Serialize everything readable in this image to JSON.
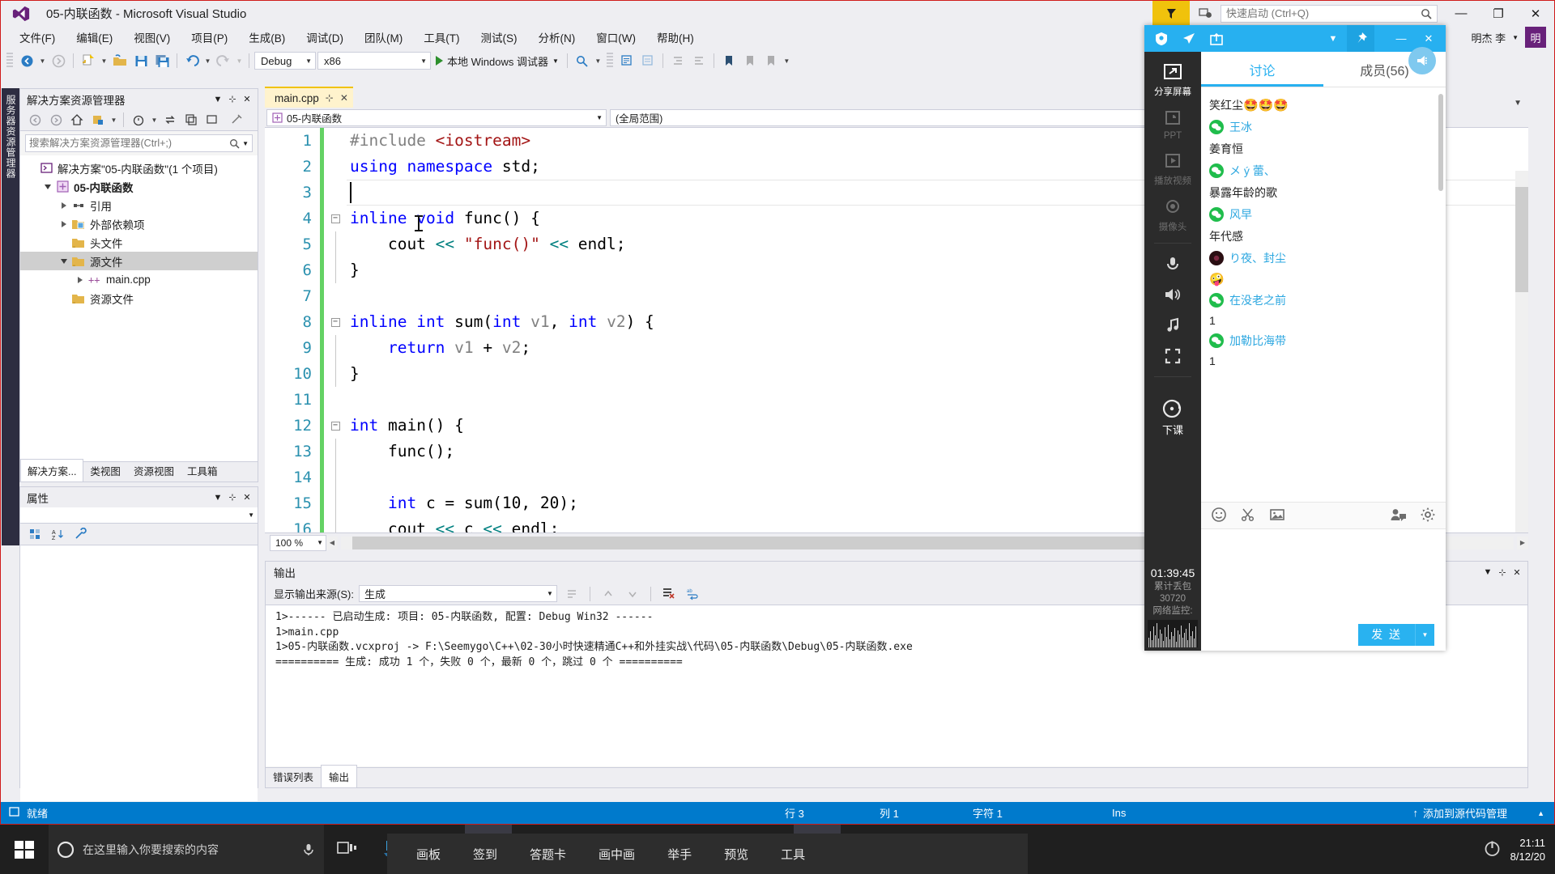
{
  "window": {
    "title": "05-内联函数 - Microsoft Visual Studio",
    "logo_icon": "visual-studio-icon",
    "feedback_icon": "feedback-flag-icon",
    "notify_icon": "notification-icon",
    "minimize": "—",
    "restore": "❐",
    "close": "✕",
    "user_name": "明杰 李",
    "avatar_initial": "明"
  },
  "quick_launch": {
    "placeholder": "快速启动 (Ctrl+Q)",
    "value": "",
    "icon": "search-icon"
  },
  "menu": [
    {
      "label": "文件(F)"
    },
    {
      "label": "编辑(E)"
    },
    {
      "label": "视图(V)"
    },
    {
      "label": "项目(P)"
    },
    {
      "label": "生成(B)"
    },
    {
      "label": "调试(D)"
    },
    {
      "label": "团队(M)"
    },
    {
      "label": "工具(T)"
    },
    {
      "label": "测试(S)"
    },
    {
      "label": "分析(N)"
    },
    {
      "label": "窗口(W)"
    },
    {
      "label": "帮助(H)"
    }
  ],
  "toolbar": {
    "config": "Debug",
    "platform": "x86",
    "run_label": "本地 Windows 调试器"
  },
  "left_strip": {
    "label": "服务器资源管理器"
  },
  "solution_explorer": {
    "title": "解决方案资源管理器",
    "search_placeholder": "搜索解决方案资源管理器(Ctrl+;)",
    "tree": [
      {
        "label": "解决方案\"05-内联函数\"(1 个项目)",
        "depth": 0,
        "twisty": "none",
        "icon": "solution-icon",
        "bold": false,
        "selected": false
      },
      {
        "label": "05-内联函数",
        "depth": 1,
        "twisty": "down",
        "icon": "project-icon",
        "bold": true,
        "selected": false
      },
      {
        "label": "引用",
        "depth": 2,
        "twisty": "right",
        "icon": "references-icon",
        "bold": false,
        "selected": false
      },
      {
        "label": "外部依赖项",
        "depth": 2,
        "twisty": "right",
        "icon": "external-deps-icon",
        "bold": false,
        "selected": false
      },
      {
        "label": "头文件",
        "depth": 2,
        "twisty": "none",
        "icon": "folder-icon",
        "bold": false,
        "selected": false
      },
      {
        "label": "源文件",
        "depth": 2,
        "twisty": "down",
        "icon": "folder-icon",
        "bold": false,
        "selected": true
      },
      {
        "label": "main.cpp",
        "depth": 3,
        "twisty": "right",
        "icon": "cpp-file-icon",
        "bold": false,
        "selected": false
      },
      {
        "label": "资源文件",
        "depth": 2,
        "twisty": "none",
        "icon": "folder-icon",
        "bold": false,
        "selected": false
      }
    ],
    "tabs": [
      {
        "label": "解决方案...",
        "active": true
      },
      {
        "label": "类视图",
        "active": false
      },
      {
        "label": "资源视图",
        "active": false
      },
      {
        "label": "工具箱",
        "active": false
      }
    ]
  },
  "properties_panel": {
    "title": "属性"
  },
  "editor": {
    "tab": {
      "label": "main.cpp",
      "pin": "⊹",
      "close": "✕"
    },
    "nav_scope": "05-内联函数",
    "nav_member": "(全局范围)",
    "zoom": "100 %",
    "lines": [
      {
        "n": "1",
        "change": true,
        "fold": "",
        "tokens": [
          {
            "t": "#include ",
            "c": "pp"
          },
          {
            "t": "<iostream>",
            "c": "inc"
          }
        ]
      },
      {
        "n": "2",
        "change": true,
        "fold": "",
        "tokens": [
          {
            "t": "using",
            "c": "k"
          },
          {
            "t": " ",
            "c": "pl"
          },
          {
            "t": "namespace",
            "c": "k"
          },
          {
            "t": " std;",
            "c": "pl"
          }
        ]
      },
      {
        "n": "3",
        "change": true,
        "fold": "",
        "tokens": [
          {
            "t": "",
            "c": "pl"
          }
        ],
        "caret": true
      },
      {
        "n": "4",
        "change": true,
        "fold": "minus",
        "tokens": [
          {
            "t": "inline",
            "c": "k"
          },
          {
            "t": " ",
            "c": "pl"
          },
          {
            "t": "void",
            "c": "k"
          },
          {
            "t": " func() {",
            "c": "pl"
          }
        ]
      },
      {
        "n": "5",
        "change": true,
        "fold": "",
        "tokens": [
          {
            "t": "    cout ",
            "c": "pl"
          },
          {
            "t": "<<",
            "c": "op"
          },
          {
            "t": " ",
            "c": "pl"
          },
          {
            "t": "\"func()\"",
            "c": "str"
          },
          {
            "t": " ",
            "c": "pl"
          },
          {
            "t": "<<",
            "c": "op"
          },
          {
            "t": " endl;",
            "c": "pl"
          }
        ]
      },
      {
        "n": "6",
        "change": true,
        "fold": "",
        "tokens": [
          {
            "t": "}",
            "c": "pl"
          }
        ]
      },
      {
        "n": "7",
        "change": true,
        "fold": "",
        "tokens": [
          {
            "t": "",
            "c": "pl"
          }
        ]
      },
      {
        "n": "8",
        "change": true,
        "fold": "minus",
        "tokens": [
          {
            "t": "inline",
            "c": "k"
          },
          {
            "t": " ",
            "c": "pl"
          },
          {
            "t": "int",
            "c": "k"
          },
          {
            "t": " sum(",
            "c": "pl"
          },
          {
            "t": "int",
            "c": "k"
          },
          {
            "t": " ",
            "c": "pl"
          },
          {
            "t": "v1",
            "c": "id"
          },
          {
            "t": ", ",
            "c": "pl"
          },
          {
            "t": "int",
            "c": "k"
          },
          {
            "t": " ",
            "c": "pl"
          },
          {
            "t": "v2",
            "c": "id"
          },
          {
            "t": ") {",
            "c": "pl"
          }
        ]
      },
      {
        "n": "9",
        "change": true,
        "fold": "",
        "tokens": [
          {
            "t": "    ",
            "c": "pl"
          },
          {
            "t": "return",
            "c": "k"
          },
          {
            "t": " ",
            "c": "pl"
          },
          {
            "t": "v1",
            "c": "id"
          },
          {
            "t": " + ",
            "c": "pl"
          },
          {
            "t": "v2",
            "c": "id"
          },
          {
            "t": ";",
            "c": "pl"
          }
        ]
      },
      {
        "n": "10",
        "change": true,
        "fold": "",
        "tokens": [
          {
            "t": "}",
            "c": "pl"
          }
        ]
      },
      {
        "n": "11",
        "change": true,
        "fold": "",
        "tokens": [
          {
            "t": "",
            "c": "pl"
          }
        ]
      },
      {
        "n": "12",
        "change": true,
        "fold": "minus",
        "tokens": [
          {
            "t": "int",
            "c": "k"
          },
          {
            "t": " main() {",
            "c": "pl"
          }
        ]
      },
      {
        "n": "13",
        "change": true,
        "fold": "",
        "tokens": [
          {
            "t": "    func();",
            "c": "pl"
          }
        ]
      },
      {
        "n": "14",
        "change": true,
        "fold": "",
        "tokens": [
          {
            "t": "",
            "c": "pl"
          }
        ]
      },
      {
        "n": "15",
        "change": true,
        "fold": "",
        "tokens": [
          {
            "t": "    ",
            "c": "pl"
          },
          {
            "t": "int",
            "c": "k"
          },
          {
            "t": " c = sum(",
            "c": "pl"
          },
          {
            "t": "10",
            "c": "pl"
          },
          {
            "t": ", ",
            "c": "pl"
          },
          {
            "t": "20",
            "c": "pl"
          },
          {
            "t": ");",
            "c": "pl"
          }
        ]
      },
      {
        "n": "16",
        "change": true,
        "fold": "",
        "tokens": [
          {
            "t": "    cout ",
            "c": "pl"
          },
          {
            "t": "<<",
            "c": "op"
          },
          {
            "t": " c ",
            "c": "pl"
          },
          {
            "t": "<<",
            "c": "op"
          },
          {
            "t": " endl;",
            "c": "pl"
          }
        ]
      }
    ]
  },
  "output_panel": {
    "title": "输出",
    "source_label": "显示输出来源(S):",
    "source_value": "生成",
    "lines": [
      "1>------ 已启动生成: 项目: 05-内联函数, 配置: Debug Win32 ------",
      "1>main.cpp",
      "1>05-内联函数.vcxproj -> F:\\Seemygo\\C++\\02-30小时快速精通C++和外挂实战\\代码\\05-内联函数\\Debug\\05-内联函数.exe",
      "========== 生成: 成功 1 个，失败 0 个，最新 0 个，跳过 0 个 =========="
    ],
    "tabs": [
      {
        "label": "错误列表",
        "active": false
      },
      {
        "label": "输出",
        "active": true
      }
    ]
  },
  "status_bar": {
    "state": "就绪",
    "row_label": "行 3",
    "col_label": "列 1",
    "char_label": "字符 1",
    "insert_mode": "Ins",
    "source_control": "添加到源代码管理",
    "source_control_icon": "upload-arrow-icon"
  },
  "meeting": {
    "titlebar_icons": [
      "shield-icon",
      "airplane-icon",
      "share-icon",
      "chevron-down-icon",
      "pin-icon"
    ],
    "minimize": "—",
    "close": "✕",
    "rail": [
      {
        "label": "分享屏幕",
        "icon": "share-screen-icon",
        "state": "active"
      },
      {
        "label": "PPT",
        "icon": "ppt-icon",
        "state": "dim"
      },
      {
        "label": "播放视频",
        "icon": "play-video-icon",
        "state": "dim"
      },
      {
        "label": "摄像头",
        "icon": "camera-icon",
        "state": "dim"
      }
    ],
    "rail_icons": [
      {
        "icon": "microphone-icon"
      },
      {
        "icon": "speaker-icon"
      },
      {
        "icon": "music-icon"
      },
      {
        "icon": "fullscreen-icon"
      }
    ],
    "end_class": {
      "label": "下课",
      "icon": "power-ring-icon"
    },
    "timer": "01:39:45",
    "stats_label": "累计丢包",
    "stats_value": "30720",
    "net_label": "网络监控:",
    "tabs": [
      {
        "label": "讨论",
        "active": true
      },
      {
        "label": "成员(56)",
        "active": false
      }
    ],
    "speaker_badge_icon": "megaphone-icon",
    "chat": [
      {
        "type": "msg",
        "text": "笑红尘",
        "emojis": [
          "🤩",
          "🤩",
          "🤩"
        ]
      },
      {
        "type": "name",
        "name": "王冰",
        "avatar": "wechat-avatar"
      },
      {
        "type": "msg",
        "text": "姜育恒",
        "emojis": []
      },
      {
        "type": "name",
        "name": "メ ý 蕾、",
        "avatar": "wechat-avatar"
      },
      {
        "type": "msg",
        "text": "暴露年龄的歌",
        "emojis": []
      },
      {
        "type": "name",
        "name": "风早",
        "avatar": "wechat-avatar"
      },
      {
        "type": "msg",
        "text": "年代感",
        "emojis": []
      },
      {
        "type": "name",
        "name": "り夜、封尘",
        "avatar": "dark-avatar"
      },
      {
        "type": "msg",
        "text": "",
        "emojis": [
          "🤪"
        ]
      },
      {
        "type": "name",
        "name": "在没老之前",
        "avatar": "wechat-avatar"
      },
      {
        "type": "msg",
        "text": "1",
        "emojis": []
      },
      {
        "type": "name",
        "name": "加勒比海带",
        "avatar": "wechat-avatar"
      },
      {
        "type": "msg",
        "text": "1",
        "emojis": []
      }
    ],
    "chat_tools": [
      {
        "icon": "emoji-icon"
      },
      {
        "icon": "scissors-icon"
      },
      {
        "icon": "image-icon"
      },
      {
        "icon": "private-chat-icon"
      },
      {
        "icon": "gear-icon"
      }
    ],
    "send_label": "发 送",
    "send_caret": "▼"
  },
  "taskbar": {
    "start_icon": "windows-start-icon",
    "search_placeholder": "在这里输入你要搜索的内容",
    "mic_icon": "microphone-icon",
    "apps": [
      {
        "name": "task-view-icon",
        "color": "#d9d9d9",
        "active": false
      },
      {
        "name": "remote-desktop-icon",
        "color": "#3aa0dd",
        "active": false
      },
      {
        "name": "chrome-icon",
        "color": "#e8453c",
        "active": false
      },
      {
        "name": "visual-studio-icon",
        "color": "#8b5ea8",
        "active": true
      },
      {
        "name": "file-explorer-icon",
        "color": "#ffc83d",
        "active": false
      },
      {
        "name": "powerpoint-icon",
        "color": "#d24726",
        "active": false
      },
      {
        "name": "visio-icon",
        "color": "#3a6fb0",
        "active": false
      },
      {
        "name": "wechat-icon",
        "color": "#2dc100",
        "active": false
      },
      {
        "name": "calendar-icon",
        "color": "#e8a33d",
        "active": false
      },
      {
        "name": "sublime-icon",
        "color": "#ff9800",
        "active": false
      },
      {
        "name": "classin-icon",
        "color": "#e8413c",
        "active": true
      }
    ],
    "class_tools": [
      "画板",
      "签到",
      "答题卡",
      "画中画",
      "举手",
      "预览",
      "工具"
    ],
    "power_icon": "power-icon",
    "clock_time": "21:11",
    "clock_date": "8/12/20"
  }
}
